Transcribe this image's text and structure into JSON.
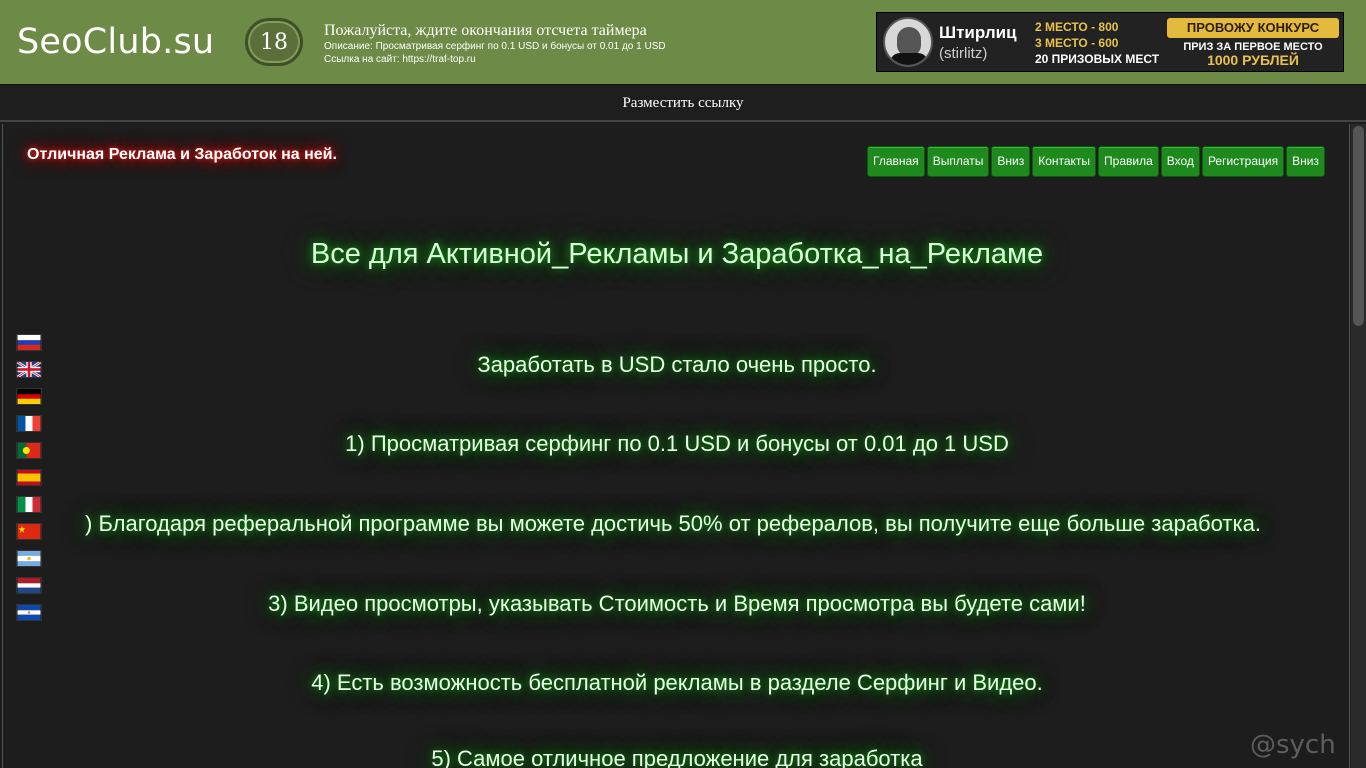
{
  "header": {
    "logo": "SeoClub.su",
    "timer": "18",
    "wait_text": "Пожалуйста, ждите окончания отсчета таймера",
    "description": "Описание: Просматривая серфинг по 0.1 USD и бонусы от 0.01 до 1 USD",
    "site_link": "Ссылка на сайт: https://traf-top.ru"
  },
  "banner": {
    "name": "Штирлиц",
    "nick": "(stirlitz)",
    "place2": "2 МЕСТО - 800",
    "place3": "3 МЕСТО - 600",
    "prizes": "20 ПРИЗОВЫХ МЕСТ",
    "contest": "ПРОВОЖУ КОНКУРС",
    "prize_text": "ПРИЗ ЗА ПЕРВОЕ МЕСТО",
    "prize_amount": "1000 РУБЛЕЙ"
  },
  "postbar": {
    "link": "Разместить ссылку"
  },
  "main": {
    "slogan": "Отличная Реклама и Заработок на ней.",
    "nav": [
      "Главная",
      "Выплаты",
      "Вниз",
      "Контакты",
      "Правила",
      "Вход",
      "Регистрация",
      "Вниз"
    ],
    "headline": "Все для Активной_Рекламы и Заработка_на_Рекламе",
    "lines": [
      "Заработать в USD стало очень просто.",
      "1) Просматривая серфинг по 0.1 USD и бонусы от 0.01 до 1 USD",
      ") Благодаря реферальной программе вы можете достичь 50% от рефералов, вы получите еще больше заработка.",
      "3) Видео просмотры, указывать Стоимость и Время просмотра вы будете сами!",
      "4) Есть возможность бесплатной рекламы в разделе Серфинг и Видео.",
      "5) Самое отличное предложение для заработка"
    ]
  },
  "flags": [
    "russia-flag",
    "uk-flag",
    "germany-flag",
    "france-flag",
    "portugal-flag",
    "spain-flag",
    "italy-flag",
    "china-flag",
    "argentina-flag",
    "netherlands-flag",
    "el-salvador-flag"
  ],
  "watermark": "@sych"
}
